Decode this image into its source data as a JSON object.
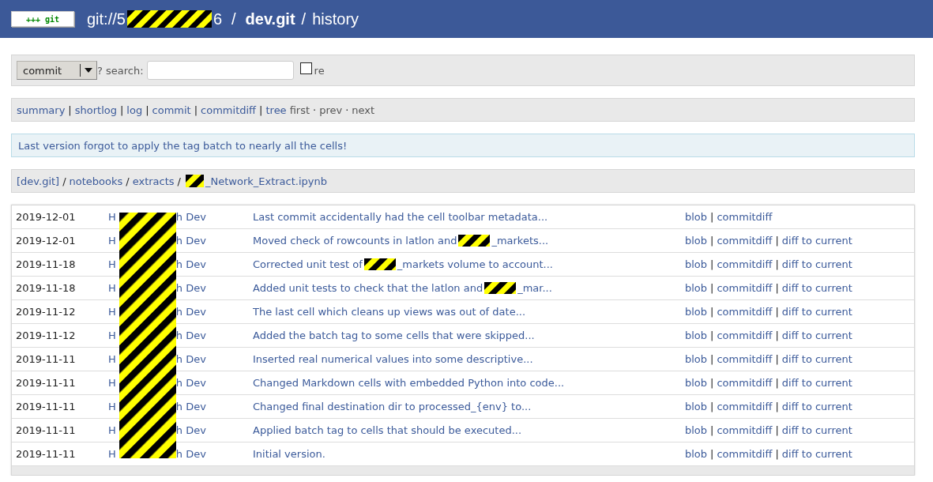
{
  "header": {
    "logo": "+++ git",
    "project_parts": [
      "git://5",
      "6"
    ],
    "separator": "/",
    "repo": "dev.git",
    "action_separator": "/",
    "action": "history"
  },
  "search": {
    "select": "commit",
    "label": "? search:",
    "regex": {
      "label": "re",
      "checked": false
    }
  },
  "nav": {
    "links": [
      "summary",
      "shortlog",
      "log",
      "commit",
      "commitdiff",
      "tree"
    ],
    "separator": "|",
    "paging": [
      "first",
      "prev",
      "next"
    ],
    "paging_separator": "·"
  },
  "message": "Last version forgot to apply the tag batch to nearly all the cells!",
  "path": {
    "root": "[dev.git]",
    "dirs": [
      "notebooks",
      "extracts"
    ],
    "separator": "/",
    "file_redacted_prefix": true,
    "file": "_Network_Extract.ipynb"
  },
  "commits": [
    {
      "date": "2019-12-01",
      "author_parts": [
        "H",
        "h Dev"
      ],
      "subject_parts": [
        "Last commit accidentally had the cell toolbar metadata..."
      ],
      "links": [
        "blob",
        "commitdiff"
      ],
      "link_separator": "|"
    },
    {
      "date": "2019-12-01",
      "author_parts": [
        "H",
        "h Dev"
      ],
      "subject_parts": [
        "Moved check of rowcounts in latlon and",
        "_markets..."
      ],
      "links": [
        "blob",
        "commitdiff",
        "diff to current"
      ],
      "link_separator": "|"
    },
    {
      "date": "2019-11-18",
      "author_parts": [
        "H",
        "h Dev"
      ],
      "subject_parts": [
        "Corrected unit test of",
        "_markets volume to account..."
      ],
      "links": [
        "blob",
        "commitdiff",
        "diff to current"
      ],
      "link_separator": "|"
    },
    {
      "date": "2019-11-18",
      "author_parts": [
        "H",
        "h Dev"
      ],
      "subject_parts": [
        "Added unit tests to check that the latlon and",
        "_mar..."
      ],
      "links": [
        "blob",
        "commitdiff",
        "diff to current"
      ],
      "link_separator": "|"
    },
    {
      "date": "2019-11-12",
      "author_parts": [
        "H",
        "h Dev"
      ],
      "subject_parts": [
        "The last cell which cleans up views was out of date..."
      ],
      "links": [
        "blob",
        "commitdiff",
        "diff to current"
      ],
      "link_separator": "|"
    },
    {
      "date": "2019-11-12",
      "author_parts": [
        "H",
        "h Dev"
      ],
      "subject_parts": [
        "Added the batch tag to some cells that were skipped..."
      ],
      "links": [
        "blob",
        "commitdiff",
        "diff to current"
      ],
      "link_separator": "|"
    },
    {
      "date": "2019-11-11",
      "author_parts": [
        "H",
        "h Dev"
      ],
      "subject_parts": [
        "Inserted real numerical values into some descriptive..."
      ],
      "links": [
        "blob",
        "commitdiff",
        "diff to current"
      ],
      "link_separator": "|"
    },
    {
      "date": "2019-11-11",
      "author_parts": [
        "H",
        "h Dev"
      ],
      "subject_parts": [
        "Changed Markdown cells with embedded Python into code..."
      ],
      "links": [
        "blob",
        "commitdiff",
        "diff to current"
      ],
      "link_separator": "|"
    },
    {
      "date": "2019-11-11",
      "author_parts": [
        "H",
        "h Dev"
      ],
      "subject_parts": [
        "Changed final destination dir to processed_{env} to..."
      ],
      "links": [
        "blob",
        "commitdiff",
        "diff to current"
      ],
      "link_separator": "|"
    },
    {
      "date": "2019-11-11",
      "author_parts": [
        "H",
        "h Dev"
      ],
      "subject_parts": [
        "Applied batch tag to cells that should be executed..."
      ],
      "links": [
        "blob",
        "commitdiff",
        "diff to current"
      ],
      "link_separator": "|"
    },
    {
      "date": "2019-11-11",
      "author_parts": [
        "H",
        "h Dev"
      ],
      "subject_parts": [
        "Initial version."
      ],
      "links": [
        "blob",
        "commitdiff",
        "diff to current"
      ],
      "link_separator": "|"
    }
  ]
}
